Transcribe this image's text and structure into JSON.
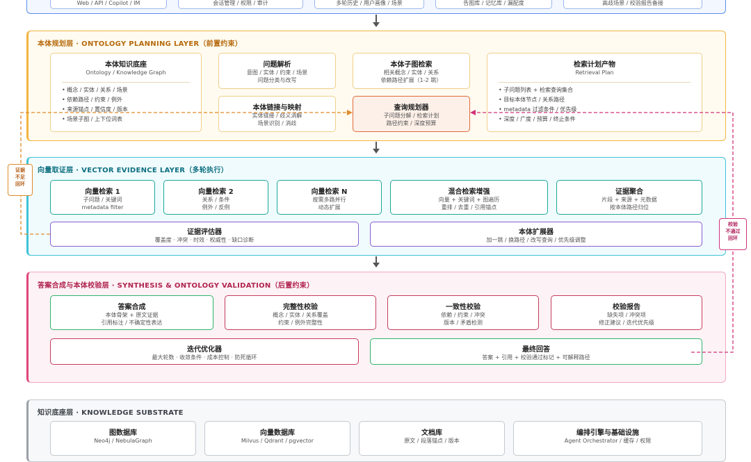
{
  "top_strip": {
    "items": [
      "Web / API / Copilot / IM",
      "会话管理 / 权限 / 审计",
      "多轮历史 / 用户画像 / 场景",
      "告图库 / 记忆库 / 漏配度",
      "高歧场景 / 校验报告备接"
    ]
  },
  "planning": {
    "title": "本体规划层 · ONTOLOGY PLANNING LAYER（前置约束）",
    "kb": {
      "title": "本体知识底座",
      "sub": "Ontology / Knowledge Graph",
      "bullets": [
        "• 概念 / 实体 / 关系 / 场景",
        "• 依赖路径 / 约束 / 例外",
        "• 来源锚点 / 置信度 / 版本",
        "• 场景子图 / 上下位词表"
      ]
    },
    "parse": {
      "title": "问题解析",
      "lines": [
        "意图 / 实体 / 约束 / 场景",
        "问题分类与改写"
      ]
    },
    "subgraph": {
      "title": "本体子图检索",
      "lines": [
        "相关概念 / 实体 / 关系",
        "依赖路径扩展（1-2 跳）"
      ]
    },
    "link": {
      "title": "本体链接与映射",
      "lines": [
        "实体链接 / 歧义消解",
        "场景识别 / 消歧"
      ]
    },
    "planner": {
      "title": "查询规划器",
      "lines": [
        "子问题分解 / 检索计划",
        "路径约束 / 深度预算"
      ]
    },
    "plan": {
      "title": "检索计划产物",
      "sub": "Retrieval Plan",
      "bullets": [
        "• 子问题列表 + 检索查询集合",
        "• 目标本体节点 / 关系路径",
        "• metadata 过滤条件 / 优先级",
        "• 深度 / 广度 / 预算 / 终止条件"
      ]
    }
  },
  "vector": {
    "title": "向量取证层 · VECTOR EVIDENCE LAYER（多轮执行）",
    "boxes": [
      {
        "title": "向量检索 1",
        "lines": [
          "子问题 / 关键词",
          "metadata filter"
        ]
      },
      {
        "title": "向量检索 2",
        "lines": [
          "关系 / 条件",
          "例外 / 反例"
        ]
      },
      {
        "title": "向量检索 N",
        "lines": [
          "按需多路并行",
          "动态扩展"
        ]
      },
      {
        "title": "混合检索增强",
        "lines": [
          "向量 + 关键词 + 图遍历",
          "重排 / 去重 / 引用锚点"
        ]
      },
      {
        "title": "证据聚合",
        "lines": [
          "片段 + 来源 + 元数据",
          "按本体路径归位"
        ]
      }
    ],
    "evaluator": {
      "title": "证据评估器",
      "line": "覆盖度 · 冲突 · 时效 · 权威性 · 缺口诊断"
    },
    "expander": {
      "title": "本体扩展器",
      "line": "加一跳 / 换路径 / 改写查询 / 优先级调整"
    }
  },
  "synthesis": {
    "title": "答案合成与本体校验层 · SYNTHESIS & ONTOLOGY VALIDATION（后置约束）",
    "boxes": [
      {
        "title": "答案合成",
        "lines": [
          "本体骨架 + 原文证据",
          "引用标注 / 不确定性表达"
        ]
      },
      {
        "title": "完整性校验",
        "lines": [
          "概念 / 实体 / 关系覆盖",
          "约束 / 例外完整性"
        ]
      },
      {
        "title": "一致性校验",
        "lines": [
          "依赖 / 约束 / 冲突",
          "版本 / 矛盾检测"
        ]
      },
      {
        "title": "校验报告",
        "lines": [
          "缺失项 / 冲突项",
          "修正建议 / 迭代优先级"
        ]
      }
    ],
    "optimizer": {
      "title": "迭代优化器",
      "line": "最大轮数 · 收敛条件 · 成本控制 · 防死循环"
    },
    "final": {
      "title": "最终回答",
      "line": "答案 + 引用 + 校验通过标记 + 可解释路径"
    }
  },
  "substrate": {
    "title": "知识底座层 · KNOWLEDGE SUBSTRATE",
    "boxes": [
      {
        "title": "图数据库",
        "line": "Neo4j / NebulaGraph"
      },
      {
        "title": "向量数据库",
        "line": "Milvus / Qdrant / pgvector"
      },
      {
        "title": "文档库",
        "line": "原文 / 段落锚点 / 版本"
      },
      {
        "title": "编排引擎与基础设施",
        "line": "Agent Orchestrator / 缓存 / 权限"
      }
    ]
  },
  "loops": {
    "left": [
      "证据",
      "不足",
      "回环"
    ],
    "right": [
      "校验",
      "不通过",
      "回环"
    ]
  },
  "colors": {
    "planning": "#f3b43f",
    "vector": "#3fc3d8",
    "synthesis": "#e0457b",
    "substrate": "#9aa0a6",
    "top": "#5b8def",
    "teal": "#1aa89a",
    "purple": "#8a5cd1",
    "green": "#2fb36b",
    "red": "#c43b5e",
    "orange": "#e06a3c"
  }
}
